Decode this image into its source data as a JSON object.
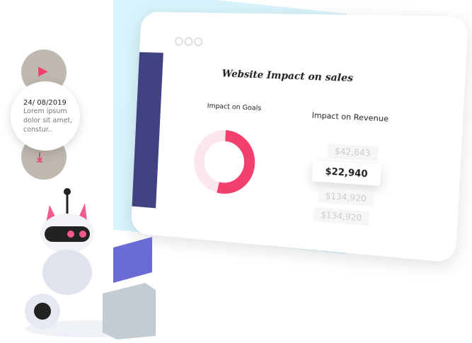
{
  "card": {
    "date": "24/ 08/2019",
    "text": "Lorem ipsum dolor sit amet, constur.."
  },
  "screen": {
    "title": "Website Impact on sales",
    "goals_label": "Impact on Goals",
    "revenue_label": "Impact on Revenue",
    "revenue_values": [
      "$42,643",
      "$22,940",
      "$134,920",
      "$134,920"
    ]
  },
  "chart_data": {
    "type": "pie",
    "donut": true,
    "values": [
      53,
      47
    ],
    "colors": [
      "#f33f6e",
      "#fde7ee"
    ]
  },
  "icons": [
    "play-icon",
    "download-icon"
  ],
  "colors": {
    "accent": "#f33f6e",
    "sidebar": "#414282",
    "backdrop": "#d8f3fb"
  }
}
